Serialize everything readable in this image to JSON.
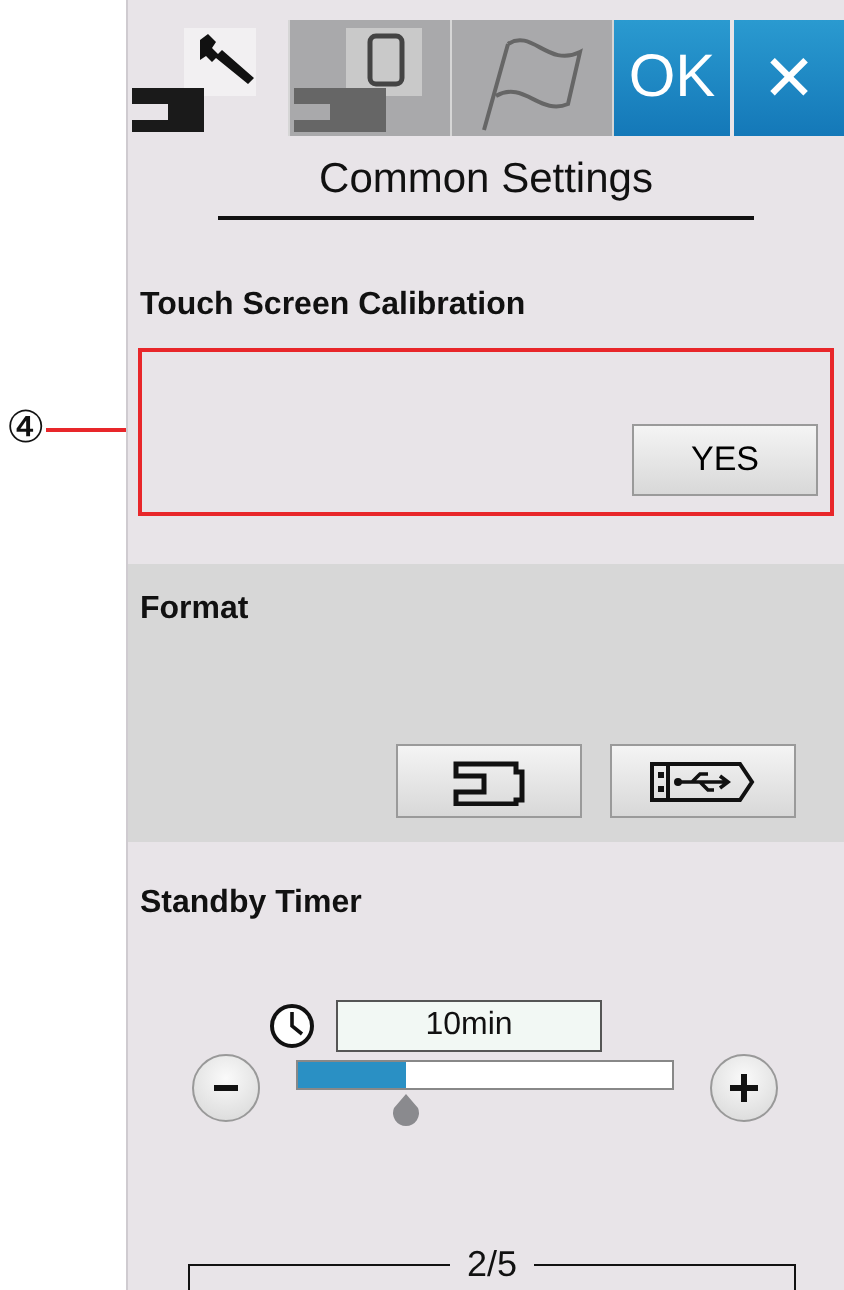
{
  "tabs": [
    {
      "kind": "settings",
      "selected": true
    },
    {
      "kind": "embroidery",
      "selected": false
    },
    {
      "kind": "language",
      "selected": false
    }
  ],
  "ok_button": {
    "label": "OK"
  },
  "close_button": {
    "label": "✕"
  },
  "title": "Common Settings",
  "sections": [
    {
      "kind": "calibration",
      "label": "Touch Screen Calibration",
      "button": "YES",
      "highlighted": true,
      "callout": "④"
    },
    {
      "kind": "format",
      "label": "Format"
    },
    {
      "kind": "timer",
      "label": "Standby Timer",
      "value": "10min",
      "level": 0.29
    }
  ],
  "page_indicator": "2/5"
}
